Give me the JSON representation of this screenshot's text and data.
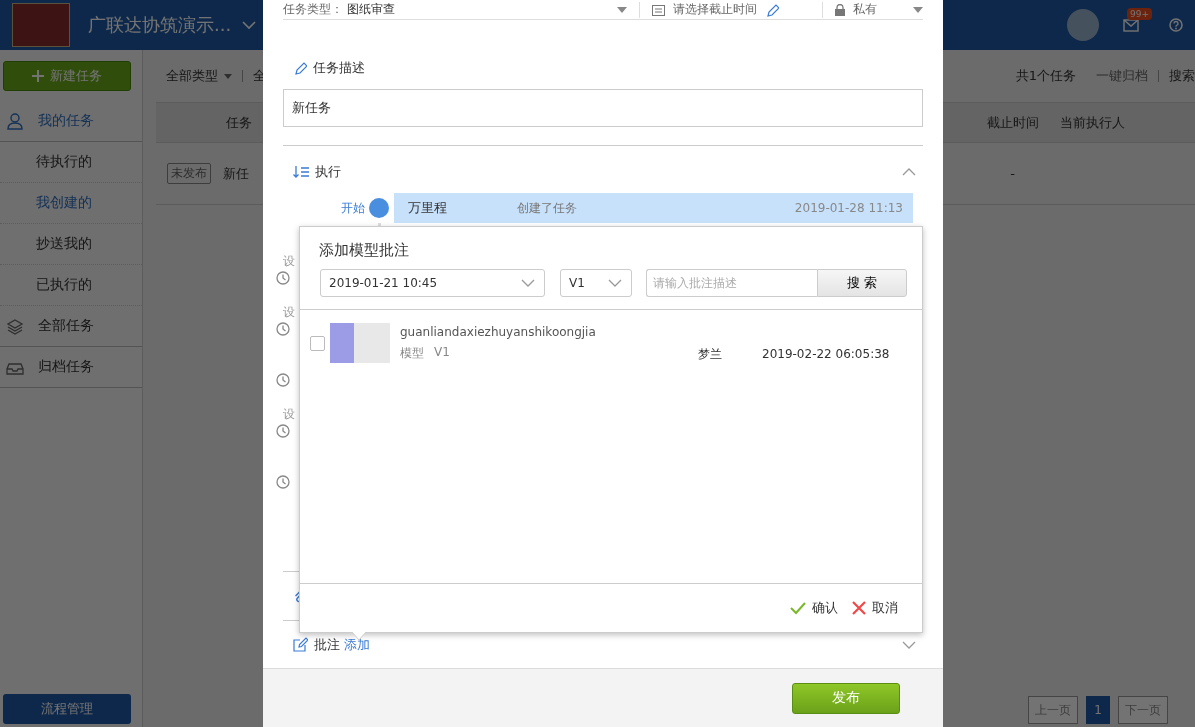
{
  "header": {
    "project_title": "广联达协筑演示...",
    "mail_badge": "99+"
  },
  "sidebar": {
    "new_button": "新建任务",
    "items": [
      {
        "kind": "group",
        "label": "我的任务",
        "active": true
      },
      {
        "kind": "item",
        "label": "待执行的",
        "selected": false
      },
      {
        "kind": "item",
        "label": "我创建的",
        "selected": true
      },
      {
        "kind": "item",
        "label": "抄送我的",
        "selected": false
      },
      {
        "kind": "item",
        "label": "已执行的",
        "selected": false
      },
      {
        "kind": "group",
        "label": "全部任务",
        "active": false
      },
      {
        "kind": "group",
        "label": "归档任务",
        "active": false
      }
    ],
    "bottom_button": "流程管理"
  },
  "toolbar": {
    "type_filter": "全部类型",
    "filter_2": "全",
    "count": "共1个任务",
    "archive": "一键归档",
    "search": "搜索"
  },
  "table": {
    "columns": [
      "任务",
      "截止时间",
      "当前执行人"
    ],
    "rows": [
      {
        "status": "未发布",
        "name": "新任",
        "deadline": "-"
      }
    ]
  },
  "pagination": {
    "prev": "上一页",
    "pages": [
      {
        "label": "1",
        "selected": true
      }
    ],
    "next": "下一页"
  },
  "dialog": {
    "task_type_label": "任务类型：",
    "task_type": "图纸审查",
    "deadline_placeholder": "请选择截止时间",
    "visibility": "私有",
    "description_label": "任务描述",
    "description": "新任务",
    "execute_label": "执行",
    "execute_expanded": true,
    "timeline": {
      "start_label": "开始",
      "entries": [
        {
          "user": "万里程",
          "action": "创建了任务",
          "time": "2019-01-28 11:13"
        }
      ],
      "steps": [
        {
          "kind": "labeled",
          "label": "设"
        },
        {
          "kind": "labeled",
          "label": "设"
        },
        {
          "kind": "plain"
        },
        {
          "kind": "labeled",
          "label": "设"
        },
        {
          "kind": "plain"
        }
      ]
    },
    "annotation_label": "批注",
    "annotation_add": "添加",
    "annotation_expanded": false,
    "publish": "发布"
  },
  "popup": {
    "title": "添加模型批注",
    "date": "2019-01-21 10:45",
    "version": "V1",
    "search_placeholder": "请输入批注描述",
    "search_button": "搜 索",
    "items": [
      {
        "checked": false,
        "name": "guanliandaxiezhuyanshikoongjia",
        "type": "模型",
        "version": "V1",
        "author": "梦兰",
        "time": "2019-02-22 06:05:38"
      }
    ],
    "confirm": "确认",
    "cancel": "取消"
  }
}
